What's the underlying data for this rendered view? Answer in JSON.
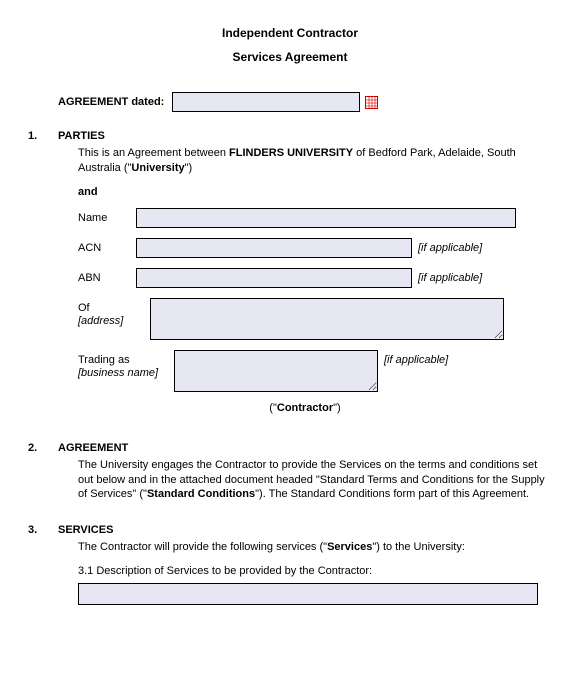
{
  "title": {
    "line1": "Independent Contractor",
    "line2": "Services Agreement"
  },
  "dated": {
    "label": "AGREEMENT dated:",
    "value": ""
  },
  "sections": {
    "parties": {
      "num": "1.",
      "heading": "PARTIES",
      "intro_before": "This is an Agreement between ",
      "intro_bold1": "FLINDERS UNIVERSITY",
      "intro_mid": " of Bedford Park, Adelaide, South Australia (\"",
      "intro_bold2": "University",
      "intro_after": "\")",
      "and": "and",
      "fields": {
        "name_label": "Name",
        "acn_label": "ACN",
        "abn_label": "ABN",
        "of_label": "Of",
        "address_hint": "[address]",
        "trading_label": "Trading as",
        "trading_hint": "[business name]",
        "if_applicable": "[if applicable]"
      },
      "contractor_open": "(\"",
      "contractor_word": "Contractor",
      "contractor_close": "\")"
    },
    "agreement": {
      "num": "2.",
      "heading": "AGREEMENT",
      "text_a": "The University engages the Contractor to provide the Services on the terms and conditions set out below and in the attached document headed \"Standard Terms and Conditions for the Supply of Services\" (\"",
      "text_bold": "Standard Conditions",
      "text_b": "\").  The Standard Conditions form part of this Agreement."
    },
    "services": {
      "num": "3.",
      "heading": "SERVICES",
      "text_a": "The Contractor will provide the following services (\"",
      "text_bold": "Services",
      "text_b": "\") to the University:",
      "sub_num": "3.1",
      "sub_text": "Description of Services to be provided by the Contractor:"
    }
  }
}
